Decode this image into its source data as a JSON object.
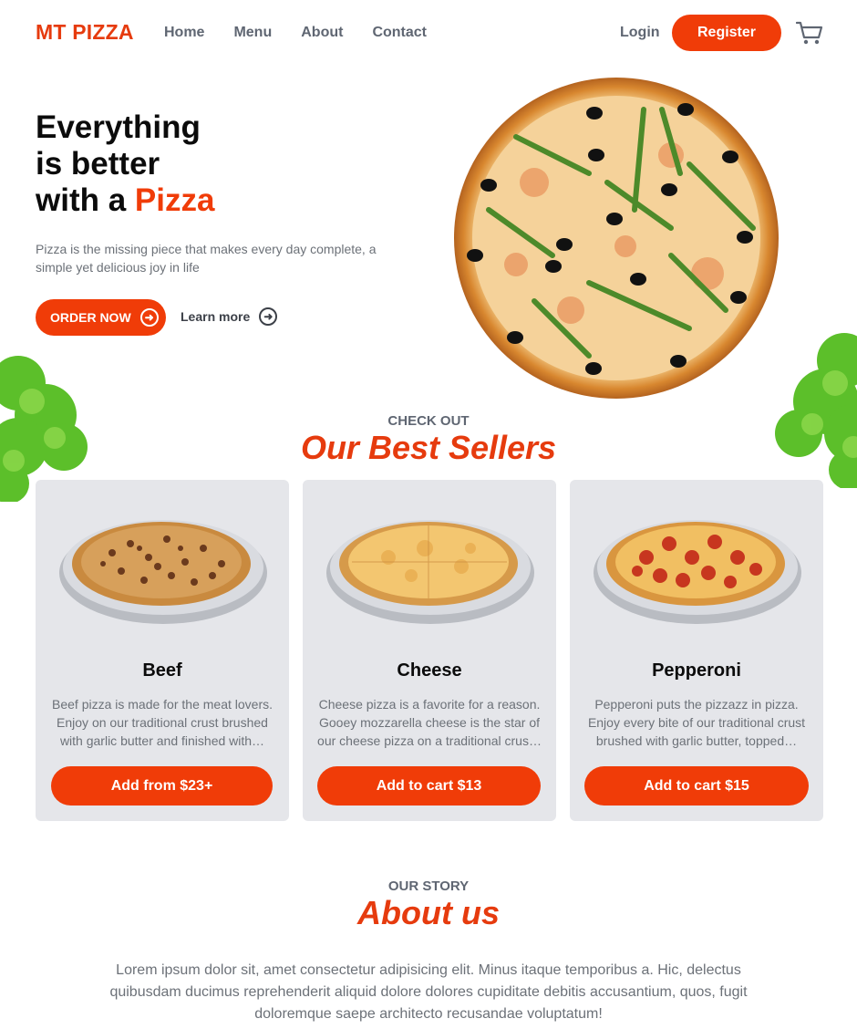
{
  "brand": {
    "name": "MT PIZZA",
    "accent_color": "#f03c08"
  },
  "nav": {
    "items": [
      {
        "label": "Home"
      },
      {
        "label": "Menu"
      },
      {
        "label": "About"
      },
      {
        "label": "Contact"
      }
    ],
    "login_label": "Login",
    "register_label": "Register",
    "cart_icon": "cart-icon"
  },
  "hero": {
    "title_line1": "Everything",
    "title_line2": "is better",
    "title_line3_prefix": "with a ",
    "title_line3_accent": "Pizza",
    "text": "Pizza is the missing piece that makes every day complete, a simple yet delicious joy in life",
    "order_label": "ORDER NOW",
    "learn_label": "Learn more",
    "arrow_icon": "arrow-right-circle-icon"
  },
  "best_sellers": {
    "kicker": "CHECK OUT",
    "title": "Our Best Sellers",
    "items": [
      {
        "name": "Beef",
        "description": "Beef pizza is made for the meat lovers. Enjoy on our traditional crust brushed with garlic butter and finished with…",
        "cta": "Add from $23+"
      },
      {
        "name": "Cheese",
        "description": "Cheese pizza is a favorite for a reason. Gooey mozzarella cheese is the star of our cheese pizza on a traditional crus…",
        "cta": "Add to cart $13"
      },
      {
        "name": "Pepperoni",
        "description": "Pepperoni puts the pizzazz in pizza. Enjoy every bite of our traditional crust brushed with garlic butter, topped…",
        "cta": "Add to cart $15"
      }
    ]
  },
  "about": {
    "kicker": "OUR STORY",
    "title": "About us",
    "text": "Lorem ipsum dolor sit, amet consectetur adipisicing elit. Minus itaque temporibus a. Hic, delectus quibusdam ducimus reprehenderit aliquid dolore dolores cupiditate debitis accusantium, quos, fugit doloremque saepe architecto recusandae voluptatum!"
  }
}
